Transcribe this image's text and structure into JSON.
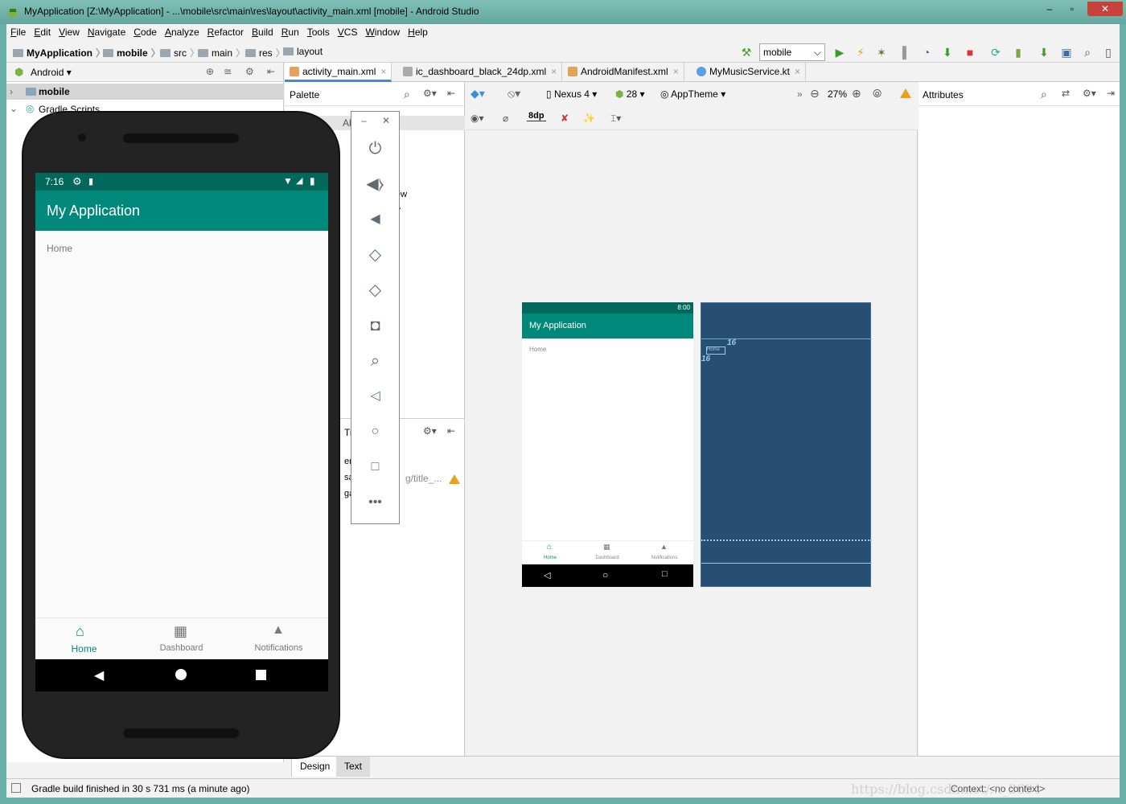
{
  "window": {
    "title": "MyApplication [Z:\\MyApplication] - ...\\mobile\\src\\main\\res\\layout\\activity_main.xml [mobile] - Android Studio"
  },
  "menu": [
    "File",
    "Edit",
    "View",
    "Navigate",
    "Code",
    "Analyze",
    "Refactor",
    "Build",
    "Run",
    "Tools",
    "VCS",
    "Window",
    "Help"
  ],
  "breadcrumbs": [
    "MyApplication",
    "mobile",
    "src",
    "main",
    "res",
    "layout"
  ],
  "run_config": "mobile",
  "project": {
    "view": "Android",
    "module": "mobile",
    "gradle": "Gradle Scripts"
  },
  "editor_tabs": [
    "activity_main.xml",
    "ic_dashboard_black_24dp.xml",
    "AndroidManifest.xml",
    "MyMusicService.kt"
  ],
  "palette": {
    "title": "Palette",
    "cat_prefix": "Ab",
    "frag1": "ew",
    "frag2": ">",
    "tree_frag": "Tre",
    "frag_r": "er",
    "frag_sa": "sag",
    "frag_ga": "ga",
    "warning_text": "g/title_..."
  },
  "design_toolbar": {
    "device": "Nexus 4",
    "api": "28",
    "theme": "AppTheme",
    "zoom": "27%",
    "margin": "8dp"
  },
  "preview": {
    "time": "8:00",
    "app_title": "My Application",
    "home": "Home",
    "tabs": [
      "Home",
      "Dashboard",
      "Notifications"
    ]
  },
  "blueprint": {
    "home_label": "Home",
    "margin1": "16",
    "margin2": "16"
  },
  "attributes": {
    "title": "Attributes"
  },
  "bottom_tabs": [
    "Design",
    "Text"
  ],
  "status": {
    "message": "Gradle build finished in 30 s 731 ms (a minute ago)",
    "context": "Context: <no context>",
    "watermark": "https://blog.csdn.net/..._3694"
  },
  "emulator": {
    "time": "7:16",
    "app_title": "My Application",
    "home_text": "Home",
    "tabs": [
      {
        "label": "Home",
        "icon": "home-icon"
      },
      {
        "label": "Dashboard",
        "icon": "dashboard-icon"
      },
      {
        "label": "Notifications",
        "icon": "bell-icon"
      }
    ],
    "toolbar": [
      "power-icon",
      "volume-up-icon",
      "volume-down-icon",
      "rotate-left-icon",
      "rotate-right-icon",
      "camera-icon",
      "zoom-icon",
      "back-icon",
      "home-icon",
      "overview-icon",
      "more-icon"
    ],
    "accent": "#00897b",
    "status_color": "#00695c"
  }
}
